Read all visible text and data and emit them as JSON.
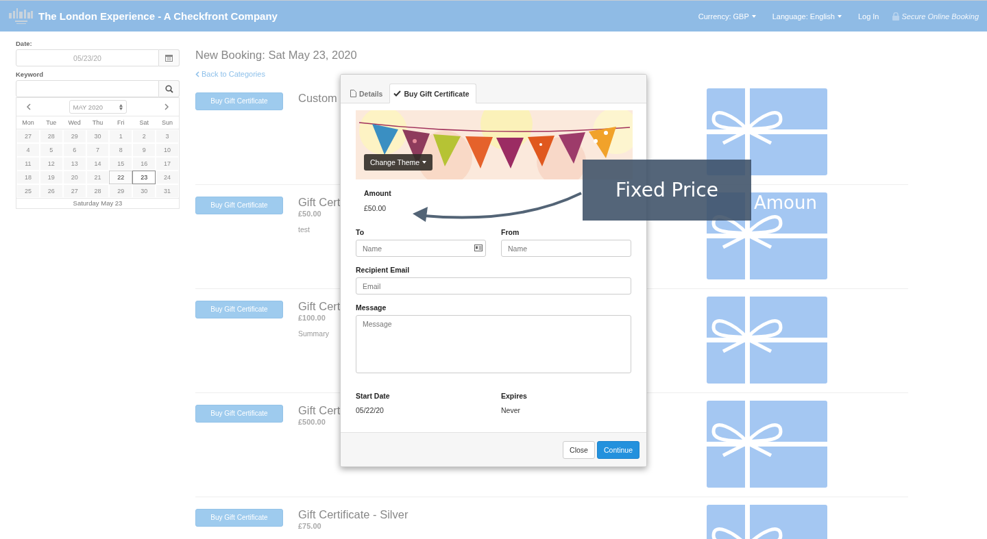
{
  "header": {
    "title": "The London Experience - A Checkfront Company",
    "menus": [
      {
        "label": "Currency: GBP",
        "kind": "dropdown"
      },
      {
        "label": "Language: English",
        "kind": "dropdown"
      },
      {
        "label": "Log In",
        "kind": "link"
      }
    ],
    "secure_label": "Secure Online Booking"
  },
  "sidebar": {
    "date_label": "Date:",
    "date_value": "05/23/20",
    "keyword_label": "Keyword",
    "calendar": {
      "month": "MAY 2020",
      "weekdays": [
        "Mon",
        "Tue",
        "Wed",
        "Thu",
        "Fri",
        "Sat",
        "Sun"
      ],
      "days": [
        {
          "day": "27",
          "today": false,
          "selected": false
        },
        {
          "day": "28",
          "today": false,
          "selected": false
        },
        {
          "day": "29",
          "today": false,
          "selected": false
        },
        {
          "day": "30",
          "today": false,
          "selected": false
        },
        {
          "day": "1",
          "today": false,
          "selected": false
        },
        {
          "day": "2",
          "today": false,
          "selected": false
        },
        {
          "day": "3",
          "today": false,
          "selected": false
        },
        {
          "day": "4",
          "today": false,
          "selected": false
        },
        {
          "day": "5",
          "today": false,
          "selected": false
        },
        {
          "day": "6",
          "today": false,
          "selected": false
        },
        {
          "day": "7",
          "today": false,
          "selected": false
        },
        {
          "day": "8",
          "today": false,
          "selected": false
        },
        {
          "day": "9",
          "today": false,
          "selected": false
        },
        {
          "day": "10",
          "today": false,
          "selected": false
        },
        {
          "day": "11",
          "today": false,
          "selected": false
        },
        {
          "day": "12",
          "today": false,
          "selected": false
        },
        {
          "day": "13",
          "today": false,
          "selected": false
        },
        {
          "day": "14",
          "today": false,
          "selected": false
        },
        {
          "day": "15",
          "today": false,
          "selected": false
        },
        {
          "day": "16",
          "today": false,
          "selected": false
        },
        {
          "day": "17",
          "today": false,
          "selected": false
        },
        {
          "day": "18",
          "today": false,
          "selected": false
        },
        {
          "day": "19",
          "today": false,
          "selected": false
        },
        {
          "day": "20",
          "today": false,
          "selected": false
        },
        {
          "day": "21",
          "today": false,
          "selected": false
        },
        {
          "day": "22",
          "today": true,
          "selected": false
        },
        {
          "day": "23",
          "today": false,
          "selected": true
        },
        {
          "day": "24",
          "today": false,
          "selected": false
        },
        {
          "day": "25",
          "today": false,
          "selected": false
        },
        {
          "day": "26",
          "today": false,
          "selected": false
        },
        {
          "day": "27",
          "today": false,
          "selected": false
        },
        {
          "day": "28",
          "today": false,
          "selected": false
        },
        {
          "day": "29",
          "today": false,
          "selected": false
        },
        {
          "day": "30",
          "today": false,
          "selected": false
        },
        {
          "day": "31",
          "today": false,
          "selected": false
        }
      ],
      "footer": "Saturday May 23"
    }
  },
  "main": {
    "heading": "New Booking: Sat May 23, 2020",
    "back_link": "Back to Categories",
    "items": [
      {
        "button": "Buy Gift Certificate",
        "title": "Custom"
      },
      {
        "button": "Buy Gift Certificate",
        "title": "Gift Cert",
        "price": "£50.00",
        "description": "test"
      },
      {
        "button": "Buy Gift Certificate",
        "title": "Gift Cert",
        "price": "£100.00",
        "description": "Summary"
      },
      {
        "button": "Buy Gift Certificate",
        "title": "Gift Cert",
        "price": "£500.00"
      },
      {
        "button": "Buy Gift Certificate",
        "title": "Gift Certificate - Silver",
        "price": "£75.00"
      }
    ]
  },
  "modal": {
    "tabs": [
      {
        "label": "Details",
        "selected": false
      },
      {
        "label": "Buy Gift Certificate",
        "selected": true
      }
    ],
    "theme_button": "Change Theme",
    "amount_label": "Amount",
    "amount_value": "£50.00",
    "fields": [
      {
        "label": "To",
        "placeholder": "Name",
        "kind": "input-card"
      },
      {
        "label": "From",
        "placeholder": "Name",
        "kind": "input"
      },
      {
        "label": "Recipient Email",
        "placeholder": "Email",
        "kind": "input"
      },
      {
        "label": "Message",
        "placeholder": "Message",
        "kind": "textarea"
      }
    ],
    "info": [
      {
        "label": "Start Date",
        "value": "05/22/20"
      },
      {
        "label": "Expires",
        "value": "Never"
      }
    ],
    "buttons": [
      {
        "label": "Close",
        "kind": "default"
      },
      {
        "label": "Continue",
        "kind": "primary"
      }
    ]
  },
  "annotation": {
    "text": "Fixed Price",
    "ghost_text": "Amoun"
  }
}
